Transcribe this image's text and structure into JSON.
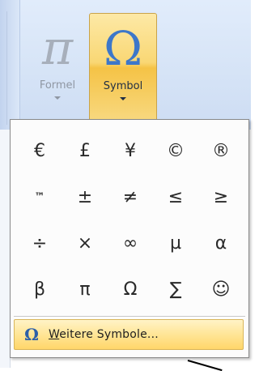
{
  "ribbon": {
    "formel": {
      "glyph": "π",
      "label": "Formel"
    },
    "symbol": {
      "glyph": "Ω",
      "label": "Symbol"
    }
  },
  "gallery": {
    "symbols": [
      "€",
      "£",
      "¥",
      "©",
      "®",
      "™",
      "±",
      "≠",
      "≤",
      "≥",
      "÷",
      "×",
      "∞",
      "µ",
      "α",
      "β",
      "π",
      "Ω",
      "∑",
      "☺"
    ]
  },
  "more_symbols": {
    "icon": "Ω",
    "label_mnemonic": "W",
    "label_rest": "eitere Symbole..."
  }
}
